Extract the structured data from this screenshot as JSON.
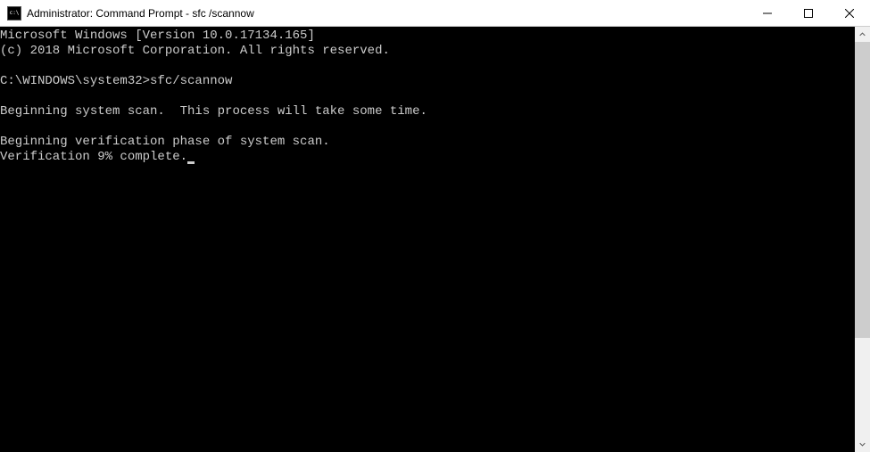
{
  "titlebar": {
    "title": "Administrator: Command Prompt - sfc /scannow"
  },
  "terminal": {
    "lines": [
      "Microsoft Windows [Version 10.0.17134.165]",
      "(c) 2018 Microsoft Corporation. All rights reserved.",
      "",
      "C:\\WINDOWS\\system32>sfc/scannow",
      "",
      "Beginning system scan.  This process will take some time.",
      "",
      "Beginning verification phase of system scan.",
      "Verification 9% complete."
    ]
  }
}
